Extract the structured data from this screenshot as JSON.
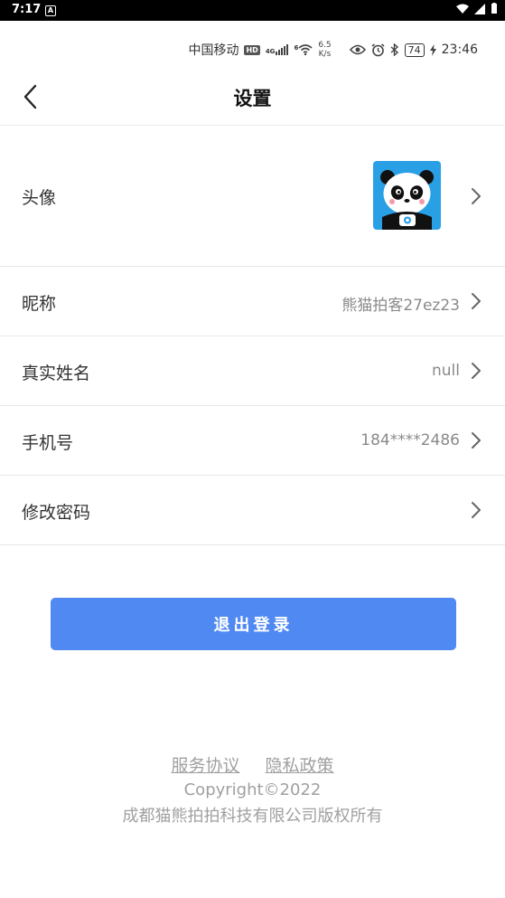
{
  "system_bar": {
    "time": "7:17",
    "notif": "A"
  },
  "status_line": {
    "carrier": "中国移动",
    "hd": "HD",
    "net": "4G",
    "wifi_num": "6",
    "speed_value": "6.5",
    "speed_unit": "K/s",
    "battery": "74",
    "clock": "23:46"
  },
  "header": {
    "title": "设置"
  },
  "rows": [
    {
      "label": "头像",
      "value": ""
    },
    {
      "label": "昵称",
      "value": "熊猫拍客27ez23"
    },
    {
      "label": "真实姓名",
      "value": "null"
    },
    {
      "label": "手机号",
      "value": "184****2486"
    },
    {
      "label": "修改密码",
      "value": ""
    }
  ],
  "logout_label": "退出登录",
  "footer": {
    "service_link": "服务协议",
    "privacy_link": "隐私政策",
    "copyright": "Copyright©2022",
    "company": "成都猫熊拍拍科技有限公司版权所有"
  },
  "colors": {
    "primary": "#5189f2",
    "avatar_bg": "#29a0e6"
  }
}
